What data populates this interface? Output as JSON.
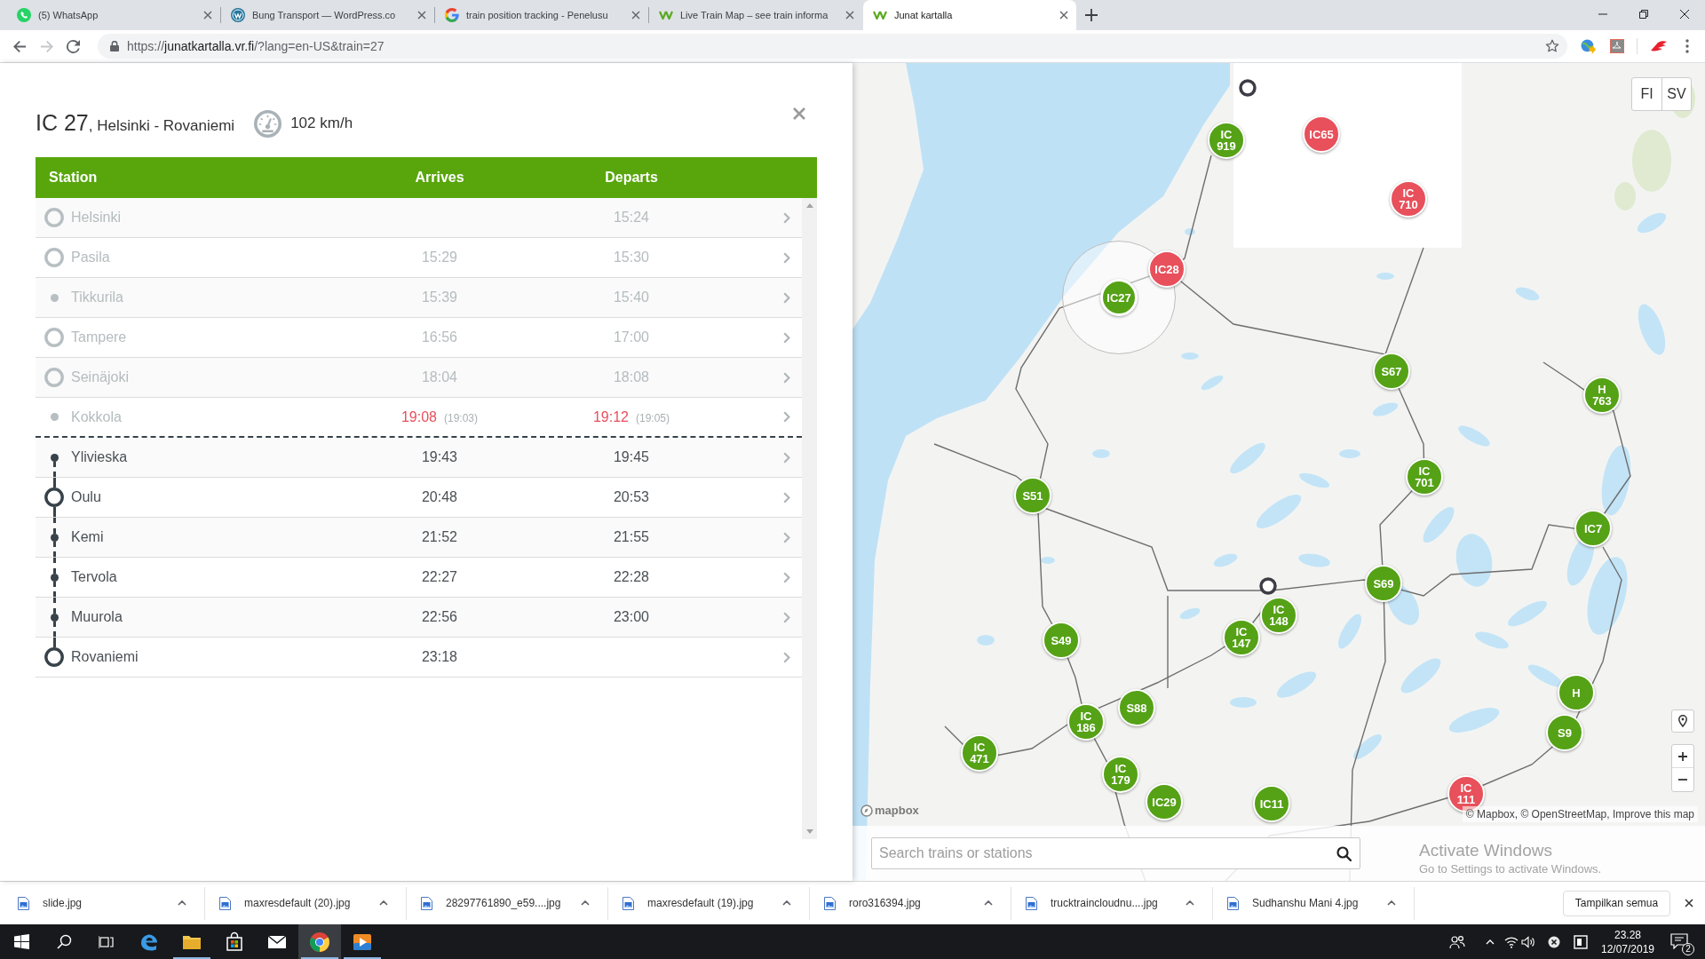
{
  "browser": {
    "tabs": [
      {
        "title": "(5) WhatsApp",
        "kind": "chat",
        "selected": false
      },
      {
        "title": "Bung Transport — WordPress.co",
        "kind": "blog",
        "selected": false
      },
      {
        "title": "train position tracking - Penelusu",
        "kind": "search",
        "selected": false
      },
      {
        "title": "Live Train Map – see train informa",
        "kind": "rail",
        "selected": false
      },
      {
        "title": "Junat kartalla",
        "kind": "rail",
        "selected": true
      }
    ],
    "nav_buttons": [
      {
        "kind": "back",
        "disabled": false
      },
      {
        "kind": "forward",
        "disabled": true
      },
      {
        "kind": "reload",
        "disabled": false
      }
    ],
    "url": {
      "scheme": "https://",
      "host": "junatkartalla.vr.fi",
      "path": "/?lang=en-US&train=27"
    }
  },
  "train_panel": {
    "train": "IC 27",
    "route": ", Helsinki - Rovaniemi",
    "speed": "102 km/h",
    "columns": [
      "Station",
      "Arrives",
      "Departs"
    ],
    "stops": [
      {
        "station": "Helsinki",
        "kind": "major",
        "passed": true,
        "departs": {
          "time": "15:24",
          "late": false
        }
      },
      {
        "station": "Pasila",
        "kind": "major",
        "passed": true,
        "arrives": {
          "time": "15:29",
          "late": false
        },
        "departs": {
          "time": "15:30",
          "late": false
        }
      },
      {
        "station": "Tikkurila",
        "kind": "minor",
        "passed": true,
        "arrives": {
          "time": "15:39",
          "late": false
        },
        "departs": {
          "time": "15:40",
          "late": false
        }
      },
      {
        "station": "Tampere",
        "kind": "major",
        "passed": true,
        "arrives": {
          "time": "16:56",
          "late": false
        },
        "departs": {
          "time": "17:00",
          "late": false
        }
      },
      {
        "station": "Seinäjoki",
        "kind": "major",
        "passed": true,
        "arrives": {
          "time": "18:04",
          "late": false
        },
        "departs": {
          "time": "18:08",
          "late": false
        }
      },
      {
        "station": "Kokkola",
        "kind": "minor",
        "passed": true,
        "arrives": {
          "time": "19:08",
          "scheduled": "(19:03)",
          "late": true
        },
        "departs": {
          "time": "19:12",
          "scheduled": "(19:05)",
          "late": true
        }
      },
      {
        "station": "Ylivieska",
        "kind": "minor",
        "passed": false,
        "arrives": {
          "time": "19:43",
          "late": false
        },
        "departs": {
          "time": "19:45",
          "late": false
        }
      },
      {
        "station": "Oulu",
        "kind": "major",
        "passed": false,
        "arrives": {
          "time": "20:48",
          "late": false
        },
        "departs": {
          "time": "20:53",
          "late": false
        }
      },
      {
        "station": "Kemi",
        "kind": "minor",
        "passed": false,
        "arrives": {
          "time": "21:52",
          "late": false
        },
        "departs": {
          "time": "21:55",
          "late": false
        }
      },
      {
        "station": "Tervola",
        "kind": "minor",
        "passed": false,
        "arrives": {
          "time": "22:27",
          "late": false
        },
        "departs": {
          "time": "22:28",
          "late": false
        }
      },
      {
        "station": "Muurola",
        "kind": "minor",
        "passed": false,
        "arrives": {
          "time": "22:56",
          "late": false
        },
        "departs": {
          "time": "23:00",
          "late": false
        }
      },
      {
        "station": "Rovaniemi",
        "kind": "major",
        "passed": false,
        "arrives": {
          "time": "23:18",
          "late": false
        }
      }
    ]
  },
  "map": {
    "language_buttons": [
      "FI",
      "SV"
    ],
    "markers": [
      {
        "label": "IC 919",
        "color": "#55a216",
        "selected": false
      },
      {
        "label": "IC65",
        "color": "#e8505b",
        "selected": false
      },
      {
        "label": "IC 710",
        "color": "#e8505b",
        "selected": false
      },
      {
        "label": "IC28",
        "color": "#e8505b",
        "selected": false
      },
      {
        "label": "IC27",
        "color": "#55a216",
        "selected": true
      },
      {
        "label": "S67",
        "color": "#55a216",
        "selected": false
      },
      {
        "label": "H 763",
        "color": "#55a216",
        "selected": false
      },
      {
        "label": "IC 701",
        "color": "#55a216",
        "selected": false
      },
      {
        "label": "S51",
        "color": "#55a216",
        "selected": false
      },
      {
        "label": "IC7",
        "color": "#55a216",
        "selected": false
      },
      {
        "label": "S69",
        "color": "#55a216",
        "selected": false
      },
      {
        "label": "IC 148",
        "color": "#55a216",
        "selected": false
      },
      {
        "label": "IC 147",
        "color": "#55a216",
        "selected": false
      },
      {
        "label": "S49",
        "color": "#55a216",
        "selected": false
      },
      {
        "label": "S88",
        "color": "#55a216",
        "selected": false
      },
      {
        "label": "IC 186",
        "color": "#55a216",
        "selected": false
      },
      {
        "label": "IC 471",
        "color": "#55a216",
        "selected": false
      },
      {
        "label": "IC 179",
        "color": "#55a216",
        "selected": false
      },
      {
        "label": "IC29",
        "color": "#55a216",
        "selected": false
      },
      {
        "label": "IC11",
        "color": "#55a216",
        "selected": false
      },
      {
        "label": "H",
        "color": "#55a216",
        "selected": false
      },
      {
        "label": "S9",
        "color": "#55a216",
        "selected": false
      },
      {
        "label": "IC 111",
        "color": "#e8505b",
        "selected": false
      }
    ],
    "logo": "mapbox",
    "attribution": "© Mapbox, © OpenStreetMap, Improve this map",
    "search": {
      "placeholder": "Search trains or stations"
    }
  },
  "activation_notice": {
    "title": "Activate Windows",
    "text": "Go to Settings to activate Windows."
  },
  "downloads": {
    "files": [
      "slide.jpg",
      "maxresdefault (20).jpg",
      "28297761890_e59....jpg",
      "maxresdefault (19).jpg",
      "roro316394.jpg",
      "trucktraincloudnu....jpg",
      "Sudhanshu Mani 4.jpg"
    ],
    "show_all": "Tampilkan semua"
  },
  "taskbar": {
    "apps": [
      {
        "kind": "edge",
        "active": false,
        "running": false
      },
      {
        "kind": "explorer",
        "active": false,
        "running": true
      },
      {
        "kind": "store",
        "active": false,
        "running": false
      },
      {
        "kind": "mail",
        "active": false,
        "running": false
      },
      {
        "kind": "chrome",
        "active": true,
        "running": true
      },
      {
        "kind": "media",
        "active": false,
        "running": true
      }
    ],
    "time": "23.28",
    "date": "12/07/2019",
    "notifications": "2"
  }
}
